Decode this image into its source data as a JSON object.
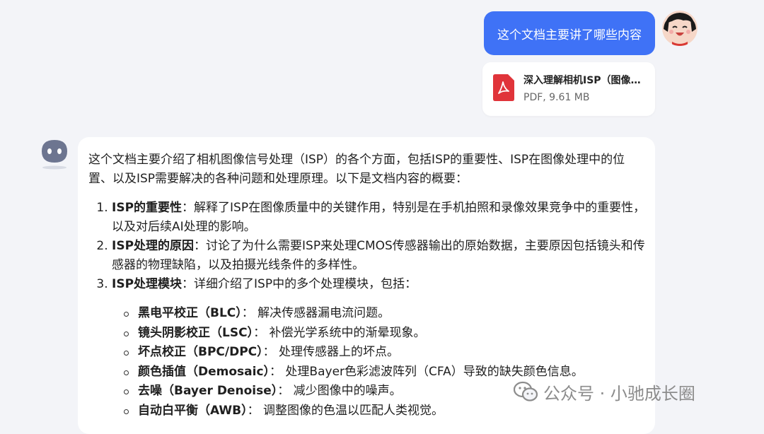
{
  "user_message": {
    "text": "这个文档主要讲了哪些内容"
  },
  "attachment": {
    "name": "深入理解相机ISP（图像信号处理）",
    "meta": "PDF, 9.61 MB",
    "icon": "pdf-icon",
    "accent_color": "#e0343a"
  },
  "answer": {
    "intro": "这个文档主要介绍了相机图像信号处理（ISP）的各个方面，包括ISP的重要性、ISP在图像处理中的位置、以及ISP需要解决的各种问题和处理原理。以下是文档内容的概要：",
    "items": [
      {
        "title": "ISP的重要性",
        "text": "：解释了ISP在图像质量中的关键作用，特别是在手机拍照和录像效果竞争中的重要性，以及对后续AI处理的影响。"
      },
      {
        "title": "ISP处理的原因",
        "text": "：讨论了为什么需要ISP来处理CMOS传感器输出的原始数据，主要原因包括镜头和传感器的物理缺陷，以及拍摄光线条件的多样性。"
      },
      {
        "title": "ISP处理模块",
        "text": "：详细介绍了ISP中的多个处理模块，包括："
      }
    ],
    "modules": [
      {
        "title": "黑电平校正（BLC）",
        "text": "： 解决传感器漏电流问题。"
      },
      {
        "title": "镜头阴影校正（LSC）",
        "text": "： 补偿光学系统中的渐晕现象。"
      },
      {
        "title": "坏点校正（BPC/DPC）",
        "text": "： 处理传感器上的坏点。"
      },
      {
        "title": "颜色插值（Demosaic）",
        "text": "： 处理Bayer色彩滤波阵列（CFA）导致的缺失颜色信息。"
      },
      {
        "title": "去噪（Bayer Denoise）",
        "text": "： 减少图像中的噪声。"
      },
      {
        "title": "自动白平衡（AWB）",
        "text": "： 调整图像的色温以匹配人类视觉。"
      }
    ]
  },
  "watermark": {
    "text": "公众号 · 小驰成长圈",
    "icon": "wechat-icon"
  },
  "colors": {
    "user_bubble": "#3f72f6",
    "background": "#f3f4f8",
    "bot_avatar": "#6d7590"
  }
}
